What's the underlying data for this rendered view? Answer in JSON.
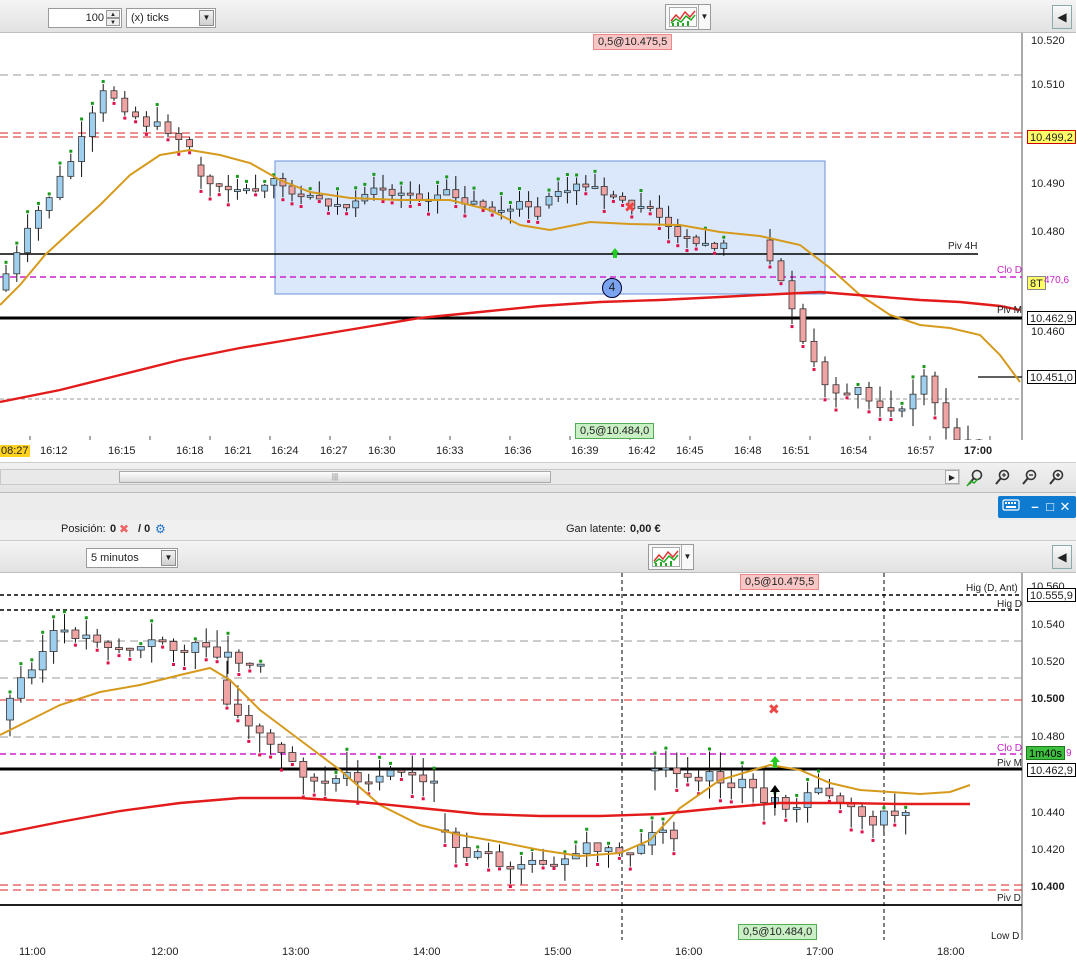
{
  "top": {
    "toolbar": {
      "quantity": "100",
      "unit": "(x) ticks"
    },
    "orders": {
      "sell_label": "0,5@10.475,5",
      "buy_label": "0,5@10.484,0"
    },
    "price_axis": [
      "10.520",
      "10.510",
      "10.490",
      "10.480",
      "10.460"
    ],
    "highlight_prices": {
      "red_level": "10.499,2",
      "current": "10.462,9",
      "black_level": "10.451,0",
      "clo_value": "470,6",
      "clo_tag": "8T"
    },
    "line_labels": {
      "piv4h": "Piv 4H",
      "clo_d": "Clo D",
      "piv_m": "Piv M"
    },
    "badge": "4",
    "time_start": "08:27",
    "time_axis": [
      "16:12",
      "16:15",
      "16:18",
      "16:21",
      "16:24",
      "16:27",
      "16:30",
      "16:33",
      "16:36",
      "16:39",
      "16:42",
      "16:45",
      "16:48",
      "16:51",
      "16:54",
      "16:57",
      "17:00"
    ]
  },
  "mid": {
    "position_label": "Posición:",
    "position_value": "0",
    "position_sep": "/ 0",
    "gain_label": "Gan latente:",
    "gain_value": "0,00 €",
    "window_buttons": [
      "keyboard-icon",
      "minimize-icon",
      "maximize-icon",
      "close-icon"
    ]
  },
  "bottom": {
    "toolbar": {
      "interval": "5 minutos"
    },
    "orders": {
      "sell_label": "0,5@10.475,5",
      "buy_label": "0,5@10.484,0"
    },
    "price_axis": [
      "10.560",
      "10.540",
      "10.520",
      "10.500",
      "10.480",
      "10.440",
      "10.420",
      "10.400"
    ],
    "highlight_prices": {
      "hig_ant": "10.555,9",
      "current": "10.462,9",
      "clo_timer": "1m40s",
      "clo_suffix": "9"
    },
    "line_labels": {
      "hig_ant": "Hig (D, Ant)",
      "hig_d": "Hig D",
      "clo_d": "Clo D",
      "piv_m": "Piv M",
      "piv_d": "Piv D",
      "low_d": "Low D"
    },
    "time_axis": [
      "11:00",
      "12:00",
      "13:00",
      "14:00",
      "15:00",
      "16:00",
      "17:00",
      "18:00"
    ]
  },
  "colors": {
    "bull": "#9ecfee",
    "bear": "#f0a3a3",
    "ema_fast": "#d69a1c",
    "ema_slow": "#e31b1b",
    "clo_line": "#cc22cc",
    "selection": "#cfe0fb",
    "accent_blue": "#0f7bd0"
  }
}
